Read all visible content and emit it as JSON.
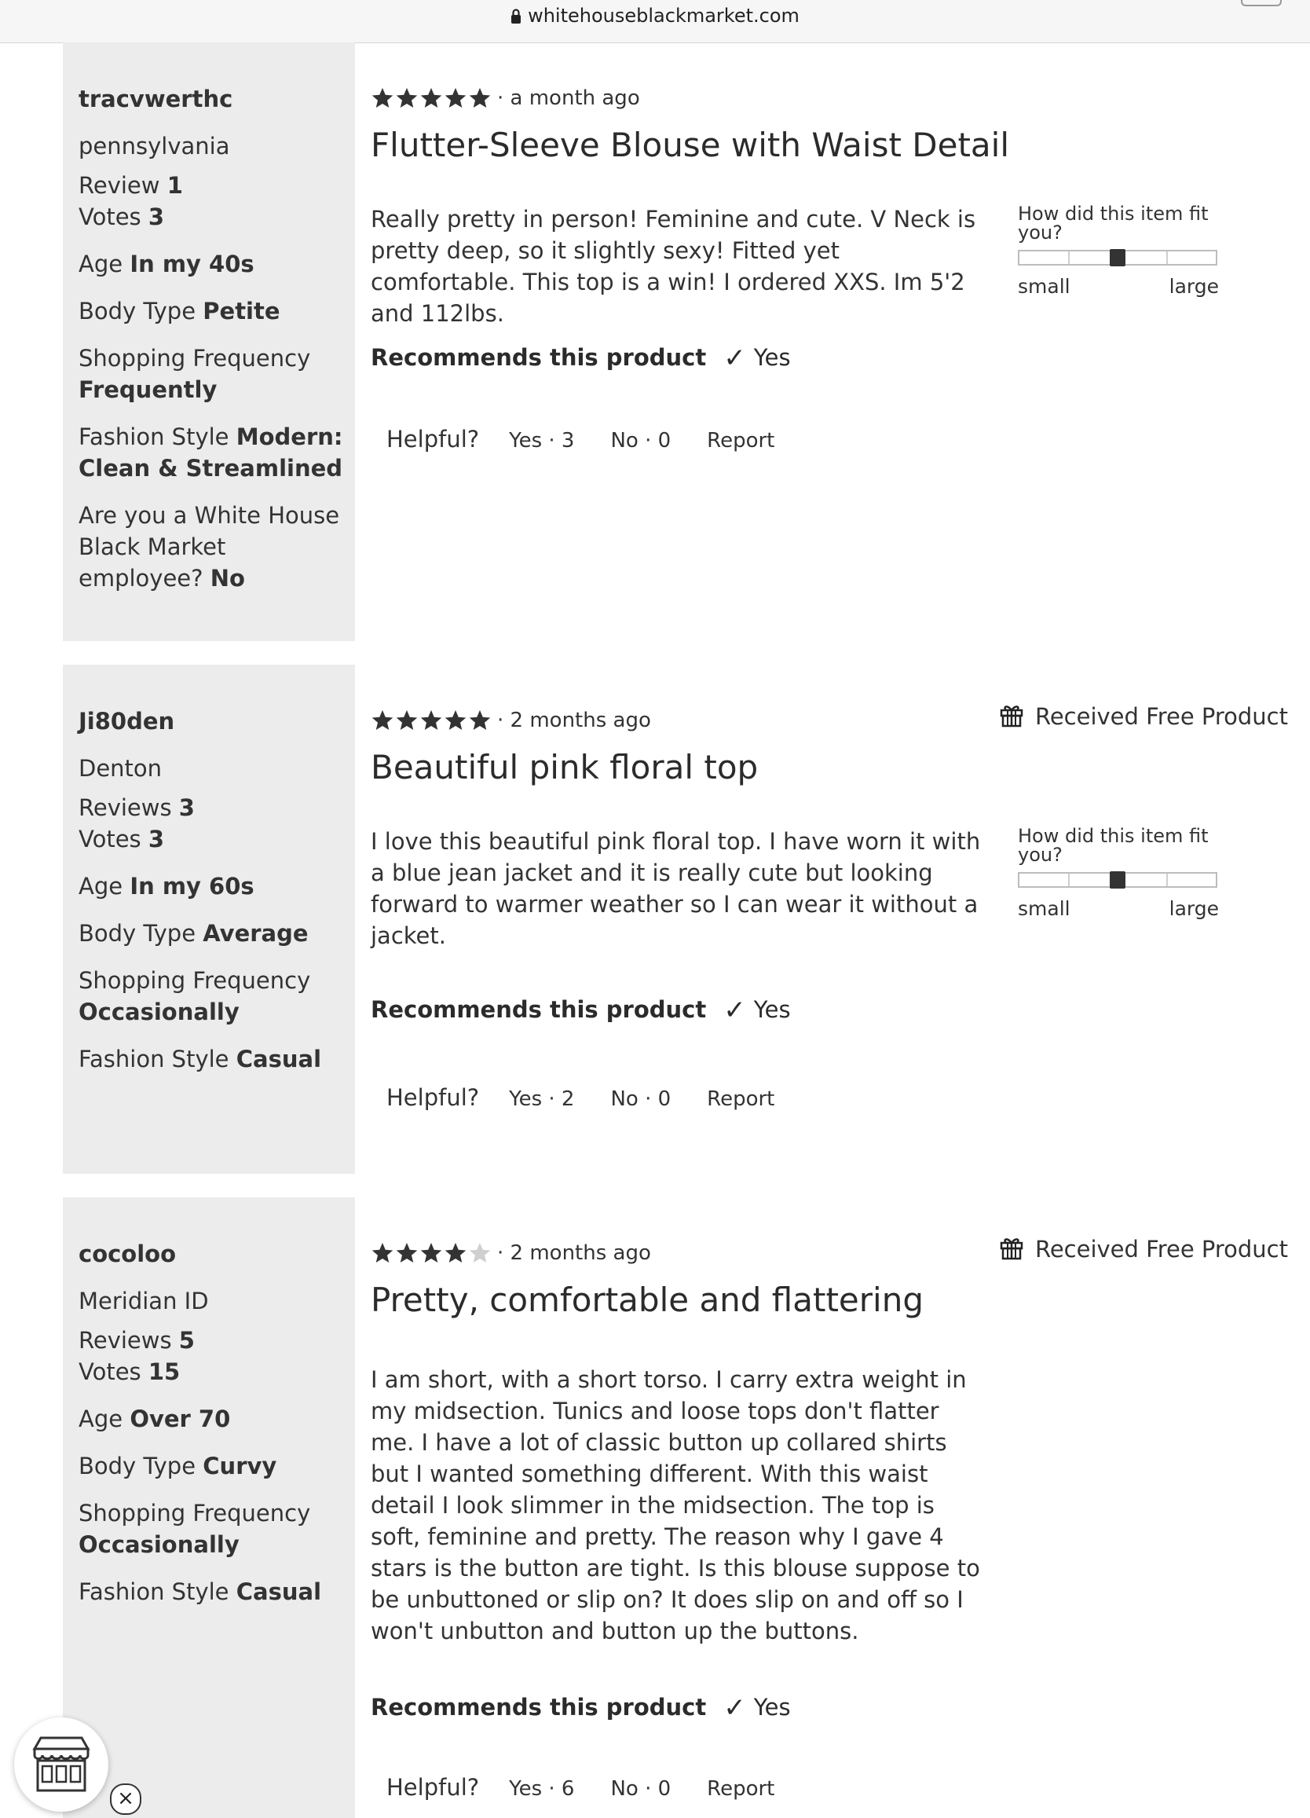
{
  "browser": {
    "url": "whitehouseblackmarket.com"
  },
  "reviews": [
    {
      "username": "tracvwerthc",
      "location": "pennsylvania",
      "reviews_label": "Review",
      "reviews_count": "1",
      "votes_label": "Votes",
      "votes_count": "3",
      "age_label": "Age",
      "age_value": "In my 40s",
      "body_label": "Body Type",
      "body_value": "Petite",
      "shopping_label": "Shopping Frequency",
      "shopping_value": "Frequently",
      "fashion_label": "Fashion Style",
      "fashion_value_1": "Modern:",
      "fashion_value_2": "Clean & Streamlined",
      "employee_line1": "Are you a White House",
      "employee_line2": "Black Market",
      "employee_line3": "employee?",
      "employee_value": "No",
      "rating": 5,
      "date": "· a month ago",
      "title": "Flutter-Sleeve Blouse with Waist Detail",
      "text": "Really pretty in person! Feminine and cute. V Neck is pretty deep, so it slightly sexy! Fitted yet comfortable. This top is a win! I ordered XXS. Im 5'2 and 112lbs.",
      "fit_question": "How did this item fit you?",
      "fit_small": "small",
      "fit_large": "large",
      "fit_value": 0.5,
      "recommends_label": "Recommends this product",
      "recommends_value": "Yes",
      "helpful_label": "Helpful?",
      "helpful_yes": "Yes · 3",
      "helpful_no": "No · 0",
      "report": "Report"
    },
    {
      "username": "Ji80den",
      "location": "Denton",
      "reviews_label": "Reviews",
      "reviews_count": "3",
      "votes_label": "Votes",
      "votes_count": "3",
      "age_label": "Age",
      "age_value": "In my 60s",
      "body_label": "Body Type",
      "body_value": "Average",
      "shopping_label": "Shopping Frequency",
      "shopping_value": "Occasionally",
      "fashion_label": "Fashion Style",
      "fashion_value": "Casual",
      "rating": 5,
      "date": "· 2 months ago",
      "free_product": "Received Free Product",
      "title": "Beautiful pink floral top",
      "text": "I love this beautiful pink floral top. I have worn it with a blue jean jacket and it is really cute but looking forward to warmer weather so I can wear it without a jacket.",
      "fit_question": "How did this item fit you?",
      "fit_small": "small",
      "fit_large": "large",
      "fit_value": 0.5,
      "recommends_label": "Recommends this product",
      "recommends_value": "Yes",
      "helpful_label": "Helpful?",
      "helpful_yes": "Yes · 2",
      "helpful_no": "No · 0",
      "report": "Report"
    },
    {
      "username": "cocoloo",
      "location": "Meridian ID",
      "reviews_label": "Reviews",
      "reviews_count": "5",
      "votes_label": "Votes",
      "votes_count": "15",
      "age_label": "Age",
      "age_value": "Over 70",
      "body_label": "Body Type",
      "body_value": "Curvy",
      "shopping_label": "Shopping Frequency",
      "shopping_value": "Occasionally",
      "fashion_label": "Fashion Style",
      "fashion_value": "Casual",
      "rating": 4,
      "date": "· 2 months ago",
      "free_product": "Received Free Product",
      "title": "Pretty, comfortable and flattering",
      "text": "I am short, with a short torso. I carry extra weight in my midsection. Tunics and loose tops don't flatter me. I have a lot of classic button up collared shirts but I wanted something different. With this waist detail I look slimmer in the midsection. The top is soft, feminine and pretty. The reason why I gave 4 stars is the button are tight. Is this blouse suppose to be unbuttoned or slip on? It does slip on and off so I won't unbutton and button up the buttons.",
      "recommends_label": "Recommends this product",
      "recommends_value": "Yes",
      "helpful_label": "Helpful?",
      "helpful_yes": "Yes · 6",
      "helpful_no": "No · 0",
      "report": "Report"
    }
  ],
  "floating": {
    "store_icon": "storefront-icon",
    "close_icon": "close-icon",
    "close_glyph": "×"
  }
}
